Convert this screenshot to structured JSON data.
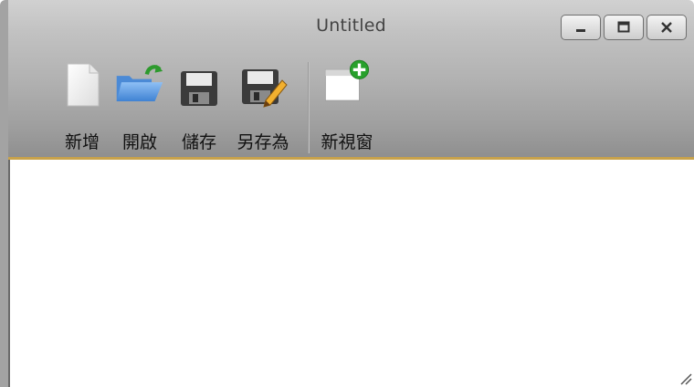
{
  "window": {
    "title": "Untitled",
    "controls": [
      {
        "name": "minimize",
        "icon": "minimize-icon"
      },
      {
        "name": "maximize",
        "icon": "maximize-icon"
      },
      {
        "name": "close",
        "icon": "close-icon"
      }
    ]
  },
  "toolbar": {
    "new_label": "新增",
    "open_label": "開啟",
    "save_label": "儲存",
    "save_as_label": "另存為",
    "new_window_label": "新視窗"
  },
  "colors": {
    "accent_border": "#c8a24b",
    "folder_blue": "#5b9be0",
    "plus_green": "#28a02c"
  },
  "editor": {
    "text": ""
  }
}
